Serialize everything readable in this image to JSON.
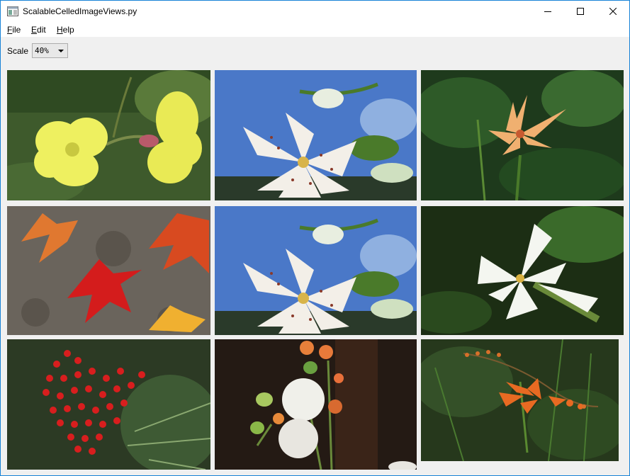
{
  "window": {
    "title": "ScalableCelledImageViews.py"
  },
  "menubar": {
    "file": "File",
    "edit": "Edit",
    "help": "Help"
  },
  "toolbar": {
    "scale_label": "Scale",
    "scale_value": "40%"
  },
  "images": [
    {
      "subject": "yellow-evening-primrose"
    },
    {
      "subject": "white-spotted-lily-blue-sky"
    },
    {
      "subject": "orange-spotted-lily-forest"
    },
    {
      "subject": "maple-leaves-on-ground"
    },
    {
      "subject": "white-spotted-lily-blue-sky"
    },
    {
      "subject": "white-trumpet-lily"
    },
    {
      "subject": "red-nandina-berries"
    },
    {
      "subject": "dandelion-seedheads"
    },
    {
      "subject": "orange-crocosmia"
    }
  ]
}
